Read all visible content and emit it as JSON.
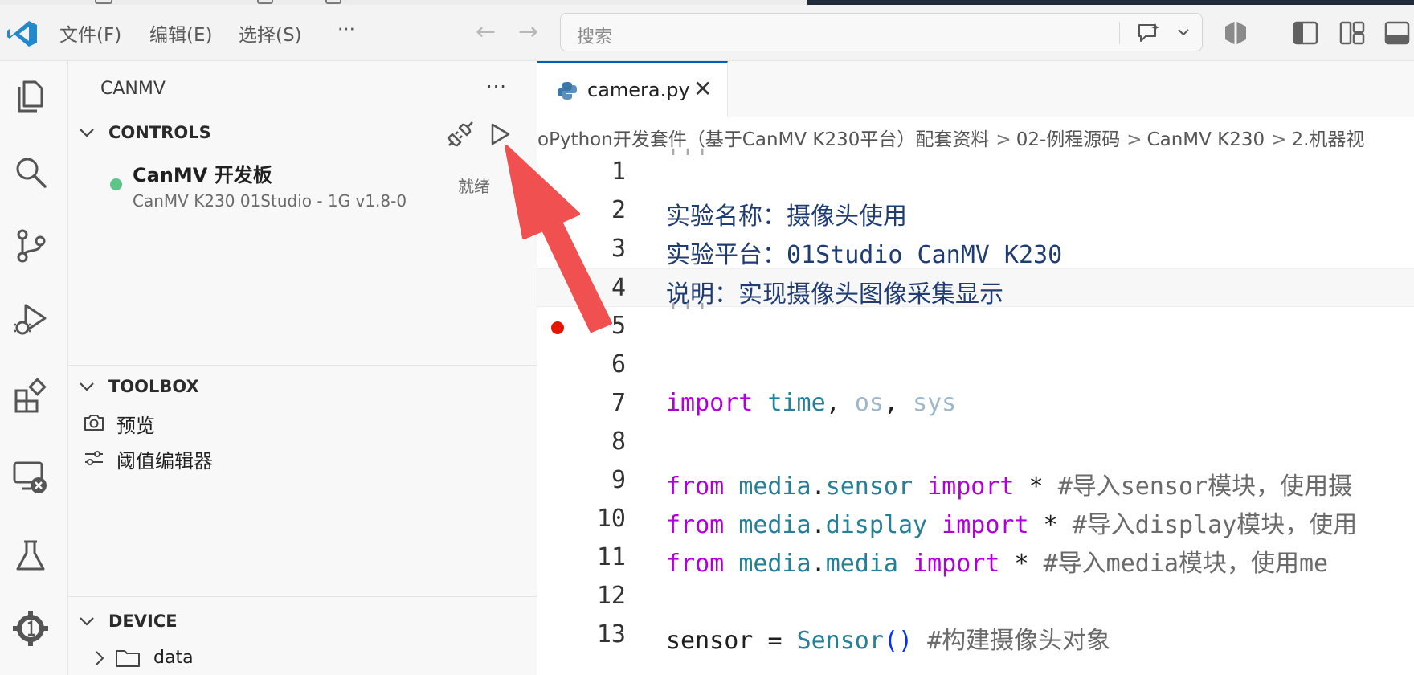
{
  "titlebar": {
    "menus": [
      "文件(F)",
      "编辑(E)",
      "选择(S)",
      "···"
    ],
    "search_placeholder": "搜索"
  },
  "sidebar": {
    "title": "CANMV",
    "more": "···",
    "controls": {
      "label": "CONTROLS",
      "device_name": "CanMV 开发板",
      "device_sub": "CanMV K230 01Studio - 1G v1.8-0",
      "status": "就绪",
      "status_color": "#5fc48a"
    },
    "toolbox": {
      "label": "TOOLBOX",
      "items": [
        {
          "label": "预览",
          "icon": "camera-icon"
        },
        {
          "label": "阈值编辑器",
          "icon": "sliders-icon"
        }
      ]
    },
    "device": {
      "label": "DEVICE",
      "folder": "data"
    }
  },
  "editor": {
    "tab": "camera.py",
    "breadcrumb": [
      "oPython开发套件（基于CanMV K230平台）配套资料",
      "02-例程源码",
      "CanMV K230",
      "2.机器视"
    ],
    "breadcrumb_sep": ">",
    "lines": [
      {
        "n": "1"
      },
      {
        "n": "2",
        "text": "实验名称：摄像头使用"
      },
      {
        "n": "3",
        "a": "实验平台：",
        "b": "01Studio CanMV K230"
      },
      {
        "n": "4",
        "text": "说明：实现摄像头图像采集显示"
      },
      {
        "n": "5"
      },
      {
        "n": "6"
      },
      {
        "n": "7"
      },
      {
        "n": "8"
      },
      {
        "n": "9",
        "comment": "#导入sensor模块，使用摄"
      },
      {
        "n": "10",
        "comment": "#导入display模块，使用"
      },
      {
        "n": "11",
        "comment": "#导入media模块，使用me"
      },
      {
        "n": "12"
      },
      {
        "n": "13",
        "comment": "#构建摄像头对象"
      }
    ],
    "tokens": {
      "quote": "'''",
      "import": "import",
      "from": "from",
      "time": "time",
      "os": "os",
      "sys": "sys",
      "comma": ",",
      "media": "media",
      "dot": ".",
      "sensor": "sensor",
      "display": "display",
      "star": "*",
      "sensor_var": "sensor",
      "eq": "=",
      "Sensor": "Sensor",
      "parens": "()"
    }
  },
  "colors": {
    "accent": "#005fb8",
    "breakpoint": "#e51400",
    "arrow": "#f0504f",
    "keyword": "#af00db",
    "module": "#267f99"
  }
}
